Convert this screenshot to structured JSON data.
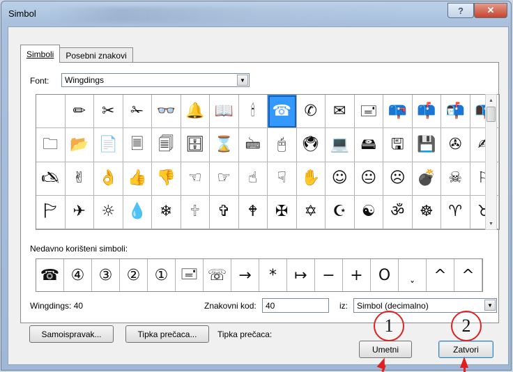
{
  "window": {
    "title": "Simbol"
  },
  "tabs": [
    {
      "label": "Simboli"
    },
    {
      "label": "Posebni znakovi"
    }
  ],
  "font": {
    "label": "Font:",
    "value": "Wingdings"
  },
  "symbol_grid": [
    [
      "",
      "✏",
      "✂",
      "✁",
      "👓",
      "🔔",
      "📖",
      "🕯",
      "☎",
      "✆",
      "✉",
      "🖃",
      "📪",
      "📫",
      "📬",
      "📭"
    ],
    [
      "🗀",
      "📂",
      "📄",
      "🗏",
      "🗐",
      "🗄",
      "⌛",
      "🖮",
      "🖰",
      "🖲",
      "💻",
      "🖴",
      "🖫",
      "💾",
      "✇",
      "✍"
    ],
    [
      "🖎",
      "✌",
      "👌",
      "👍",
      "👎",
      "☜",
      "☞",
      "☝",
      "☟",
      "✋",
      "☺",
      "😐",
      "☹",
      "💣",
      "☠",
      "⚐"
    ],
    [
      "🏱",
      "✈",
      "☼",
      "💧",
      "❄",
      "🕆",
      "✞",
      "🕈",
      "✠",
      "✡",
      "☪",
      "☯",
      "ॐ",
      "☸",
      "♈",
      "♉"
    ]
  ],
  "recent_label": "Nedavno korišteni simboli:",
  "recent_symbols": [
    "☎",
    "④",
    "③",
    "②",
    "①",
    "🖃",
    "☏",
    "→",
    "*",
    "↦",
    "−",
    "+",
    "O",
    "˯",
    "^",
    "^"
  ],
  "status": {
    "name": "Wingdings: 40",
    "code_label": "Znakovni kod:",
    "code_value": "40",
    "from_label": "iz:",
    "from_value": "Simbol (decimalno)"
  },
  "buttons": {
    "autocorrect": "Samoispravak...",
    "shortcut_key": "Tipka prečaca...",
    "shortcut_label": "Tipka prečaca:",
    "insert": "Umetni",
    "close": "Zatvori"
  },
  "annotations": {
    "one": "1",
    "two": "2"
  },
  "colors": {
    "selection": "#3399ff",
    "annotation": "#e02020"
  }
}
